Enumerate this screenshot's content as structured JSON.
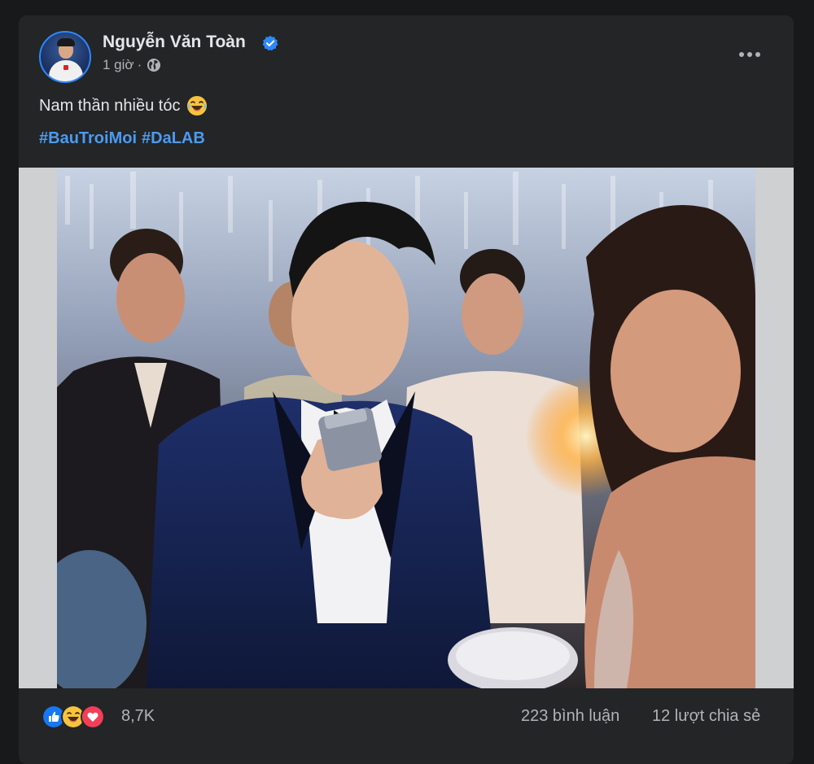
{
  "post": {
    "author": "Nguyễn Văn Toàn",
    "time": "1 giờ",
    "separator": "·",
    "text": "Nam thần nhiều tóc",
    "hashtags": [
      "#BauTroiMoi",
      "#DaLAB"
    ],
    "reactions": {
      "count": "8,7K",
      "types": [
        "like-icon",
        "haha-icon",
        "love-icon"
      ]
    },
    "comments": "223 bình luận",
    "shares": "12 lượt chia sẻ"
  },
  "icons": {
    "verified": "verified-badge-icon",
    "privacy": "globe-icon",
    "more": "more-options-icon",
    "emoji": "laughing-tears-emoji"
  },
  "colors": {
    "background": "#18191a",
    "card": "#242526",
    "text_primary": "#e4e6eb",
    "text_secondary": "#b0b3b8",
    "hashtag": "#4b9bf0",
    "verified": "#2d88ff"
  }
}
